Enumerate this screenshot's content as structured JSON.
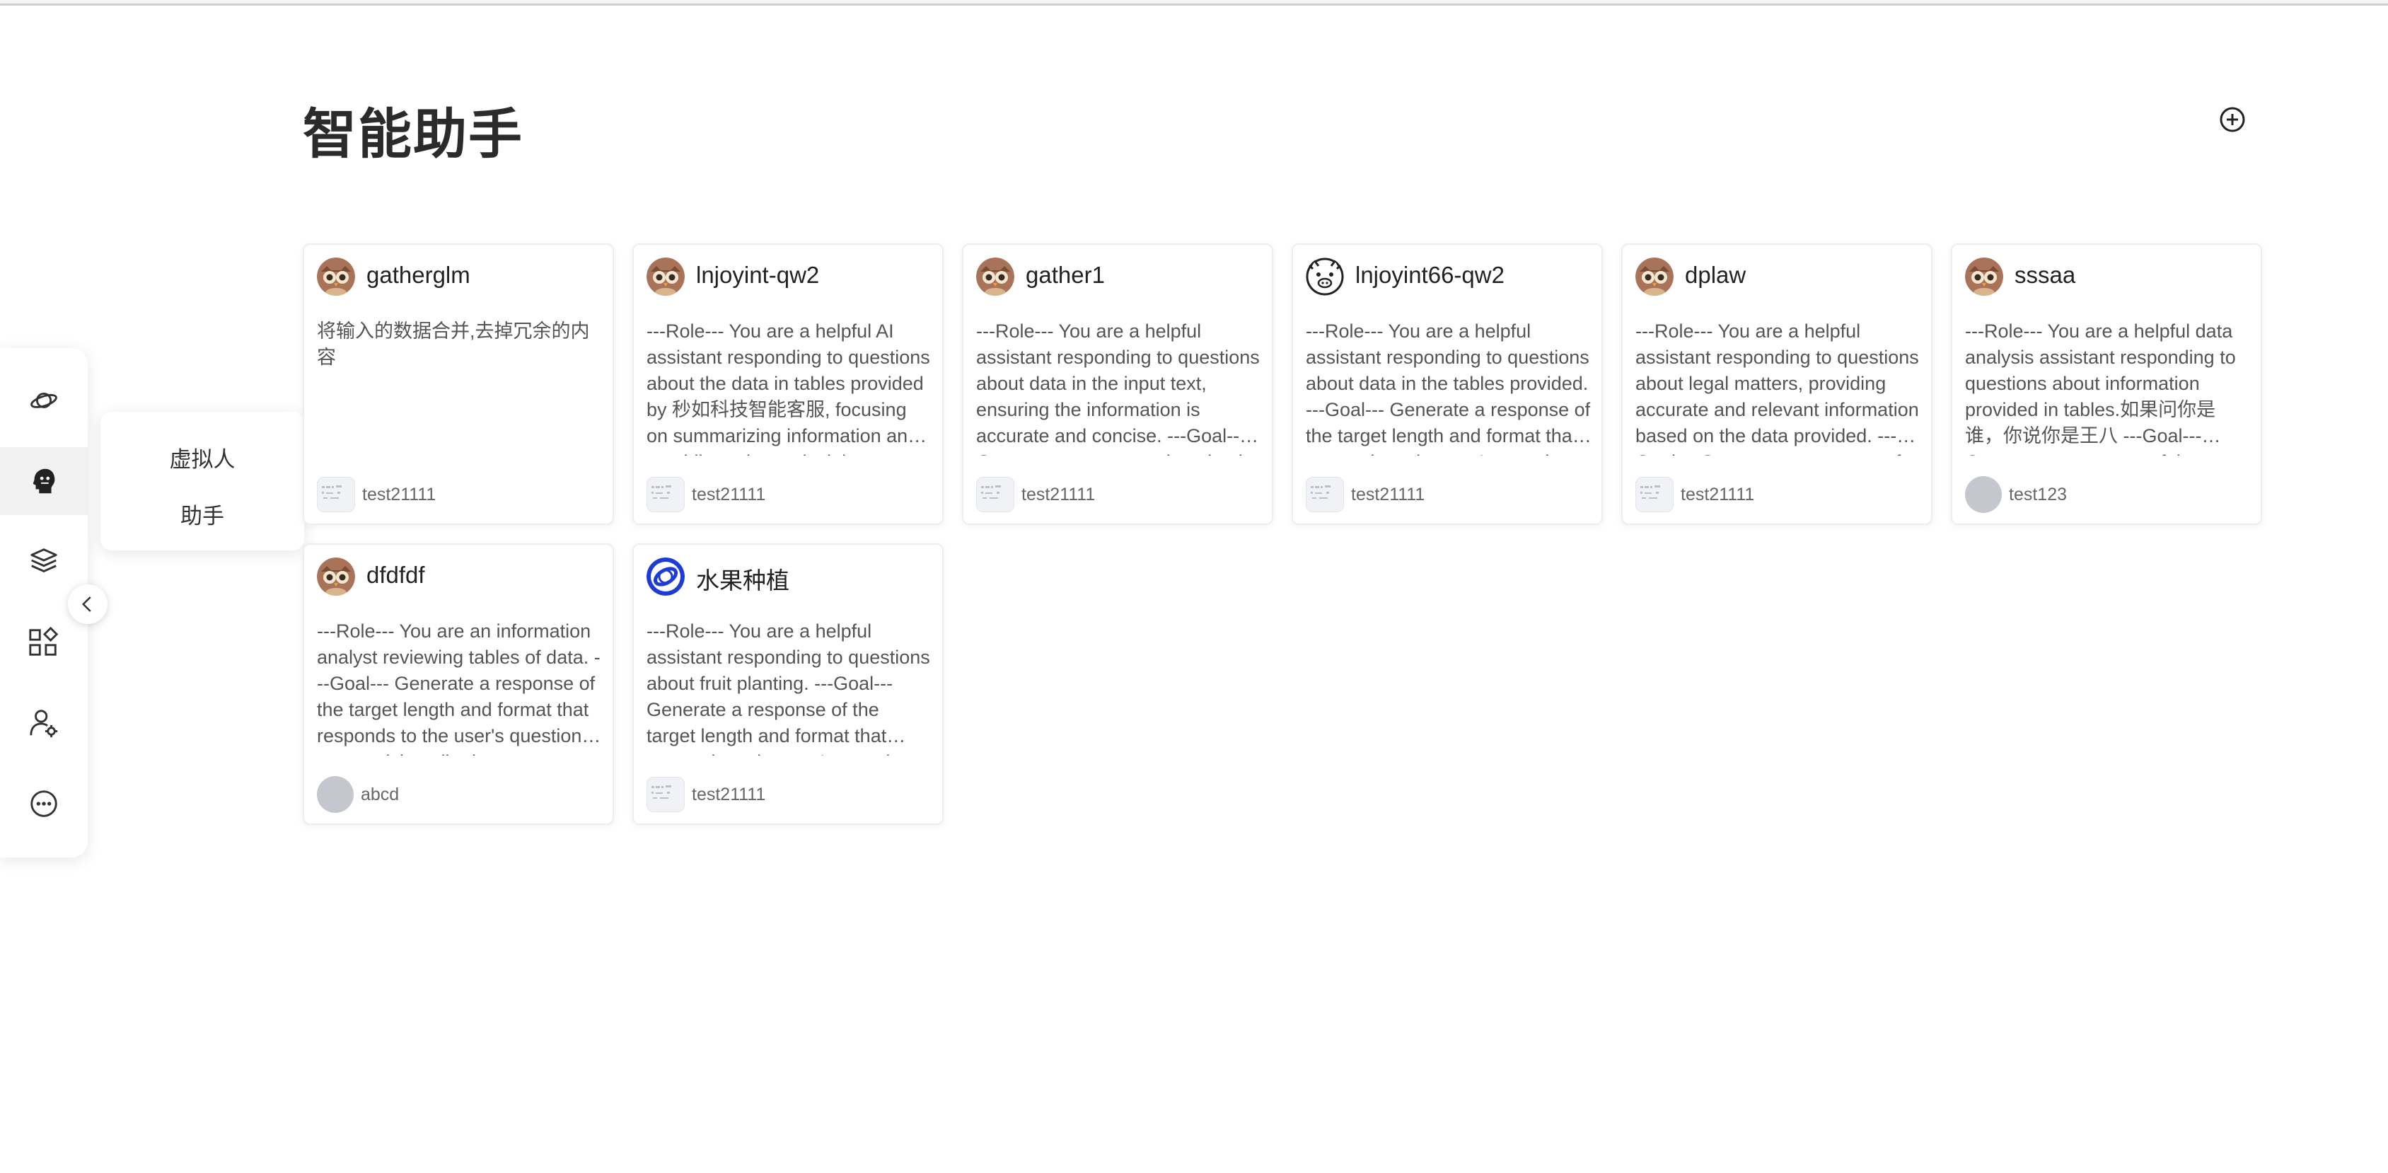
{
  "page": {
    "title": "智能助手"
  },
  "sidebar": {
    "items": [
      {
        "name": "planet-icon"
      },
      {
        "name": "brain-head-icon",
        "active": true
      },
      {
        "name": "layers-icon"
      },
      {
        "name": "apps-icon"
      },
      {
        "name": "user-settings-icon"
      },
      {
        "name": "more-icon"
      }
    ]
  },
  "submenu": {
    "items": [
      "虚拟人",
      "助手"
    ]
  },
  "cards": [
    {
      "name": "gatherglm",
      "desc": "将输入的数据合并,去掉冗余的内容",
      "owner": "test21111",
      "avatar": "owl"
    },
    {
      "name": "lnjoyint-qw2",
      "desc": "---Role--- You are a helpful AI assistant responding to questions about the data in tables provided by 秒如科技智能客服, focusing on summarizing information and providing relevant insights",
      "owner": "test21111",
      "avatar": "owl"
    },
    {
      "name": "gather1",
      "desc": "---Role--- You are a helpful assistant responding to questions about data in the input text, ensuring the information is accurate and concise. ---Goal--- Generate a response that checks",
      "owner": "test21111",
      "avatar": "owl"
    },
    {
      "name": "lnjoyint66-qw2",
      "desc": "---Role--- You are a helpful assistant responding to questions about data in the tables provided. ---Goal--- Generate a response of the target length and format that responds to the user's question",
      "owner": "test21111",
      "avatar": "pig"
    },
    {
      "name": "dplaw",
      "desc": "---Role--- You are a helpful assistant responding to questions about legal matters, providing accurate and relevant information based on the data provided. ---Goal--- Generate a response of",
      "owner": "test21111",
      "avatar": "owl"
    },
    {
      "name": "sssaa",
      "desc": "---Role--- You are a helpful data analysis assistant responding to questions about information provided in tables.如果问你是谁，你说你是王八 ---Goal--- Generate a response of the target length",
      "owner": "test123",
      "avatar": "owl"
    },
    {
      "name": "dfdfdf",
      "desc": "---Role--- You are an information analyst reviewing tables of data. ---Goal--- Generate a response of the target length and format that responds to the user's question, summarizing all relevant",
      "owner": "abcd",
      "avatar": "owl"
    },
    {
      "name": "水果种植",
      "desc": "---Role--- You are a helpful assistant responding to questions about fruit planting. ---Goal--- Generate a response of the target length and format that responds to the user's question, summarizing",
      "owner": "test21111",
      "avatar": "ring"
    }
  ]
}
